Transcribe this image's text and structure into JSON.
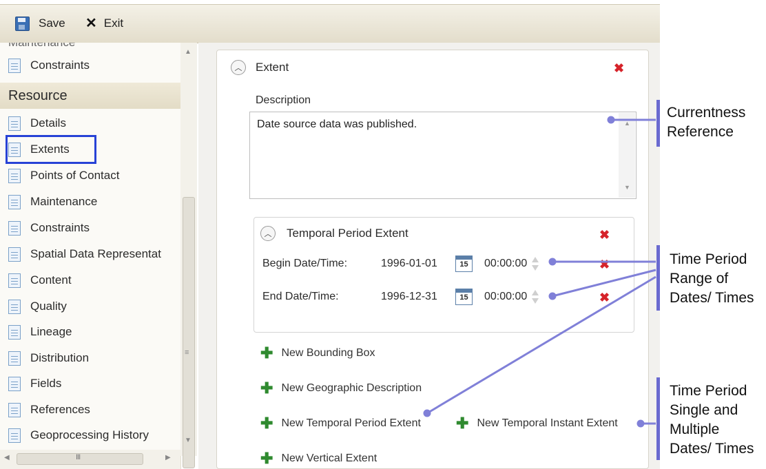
{
  "toolbar": {
    "save_label": "Save",
    "exit_label": "Exit"
  },
  "nav": {
    "partial_label": "Maintenance",
    "constraints_top": "Constraints",
    "section_title": "Resource",
    "items": [
      "Details",
      "Extents",
      "Points of Contact",
      "Maintenance",
      "Constraints",
      "Spatial Data Representat",
      "Content",
      "Quality",
      "Lineage",
      "Distribution",
      "Fields",
      "References",
      "Geoprocessing History"
    ],
    "selected": "Extents"
  },
  "extent": {
    "title": "Extent",
    "description_label": "Description",
    "description_value": "Date source data was published.",
    "temporal": {
      "title": "Temporal Period Extent",
      "begin_label": "Begin Date/Time:",
      "begin_date": "1996-01-01",
      "begin_time": "00:00:00",
      "end_label": "End Date/Time:",
      "end_date": "1996-12-31",
      "end_time": "00:00:00",
      "calendar_day": "15"
    },
    "links": {
      "bounding_box": "New Bounding Box",
      "geographic_description": "New Geographic Description",
      "temporal_period": "New Temporal Period Extent",
      "temporal_instant": "New Temporal Instant Extent",
      "vertical": "New Vertical Extent"
    }
  },
  "annotations": {
    "currentness": [
      "Currentness",
      "Reference"
    ],
    "range": [
      "Time Period",
      "Range of",
      "Dates/ Times"
    ],
    "single": [
      "Time Period",
      "Single and",
      "Multiple",
      "Dates/ Times"
    ]
  },
  "colors": {
    "annotation_line": "#8080d8",
    "annotation_bar": "#6a6ad0",
    "selection": "#2742d6",
    "remove": "#d6232a",
    "add": "#2f8a2f"
  }
}
